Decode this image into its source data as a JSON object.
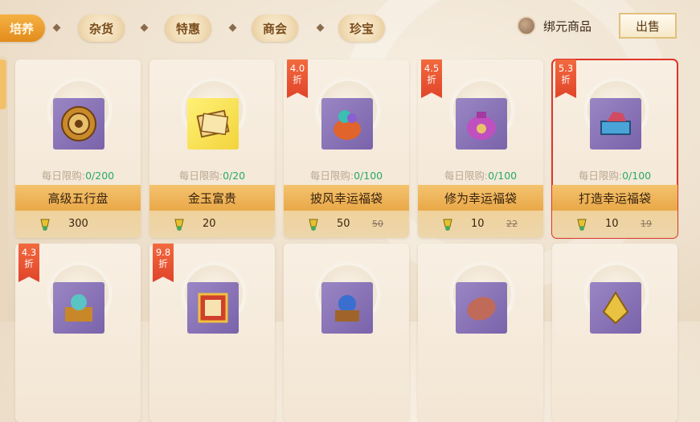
{
  "tabs": [
    {
      "label": "培养",
      "active": true
    },
    {
      "label": "杂货",
      "active": false
    },
    {
      "label": "特惠",
      "active": false
    },
    {
      "label": "商会",
      "active": false
    },
    {
      "label": "珍宝",
      "active": false
    }
  ],
  "currency": {
    "label": "绑元商品",
    "icon": "bound-coin-icon"
  },
  "sell_button": "出售",
  "limit_prefix": "每日限购:",
  "items": [
    {
      "name": "高级五行盘",
      "limit": "0/200",
      "price": "300",
      "old_price": "",
      "discount": "",
      "icon": "five-elements-compass-icon"
    },
    {
      "name": "金玉富贵",
      "limit": "0/20",
      "price": "20",
      "old_price": "",
      "discount": "",
      "icon": "gold-scroll-icon"
    },
    {
      "name": "披风幸运福袋",
      "limit": "0/100",
      "price": "50",
      "old_price": "50",
      "discount": "4.0\n折",
      "icon": "cape-lucky-bag-icon"
    },
    {
      "name": "修为幸运福袋",
      "limit": "0/100",
      "price": "10",
      "old_price": "22",
      "discount": "4.5\n折",
      "icon": "cultivation-lucky-bag-icon"
    },
    {
      "name": "打造幸运福袋",
      "limit": "0/100",
      "price": "10",
      "old_price": "19",
      "discount": "5.3\n折",
      "icon": "forge-lucky-bag-icon",
      "selected": true
    }
  ],
  "row2_items": [
    {
      "discount": "4.3\n折",
      "icon": "gem-treasure-box-icon"
    },
    {
      "discount": "9.8\n折",
      "icon": "golden-scroll-frame-icon"
    },
    {
      "discount": "",
      "icon": "blue-orb-chest-icon"
    },
    {
      "discount": "",
      "icon": "red-stone-icon"
    },
    {
      "discount": "",
      "icon": "gold-charm-icon"
    }
  ],
  "colors": {
    "accent": "#e9a848",
    "discount": "#e0442a",
    "limit_count": "#29a86a",
    "selected_border": "#e0352b"
  }
}
